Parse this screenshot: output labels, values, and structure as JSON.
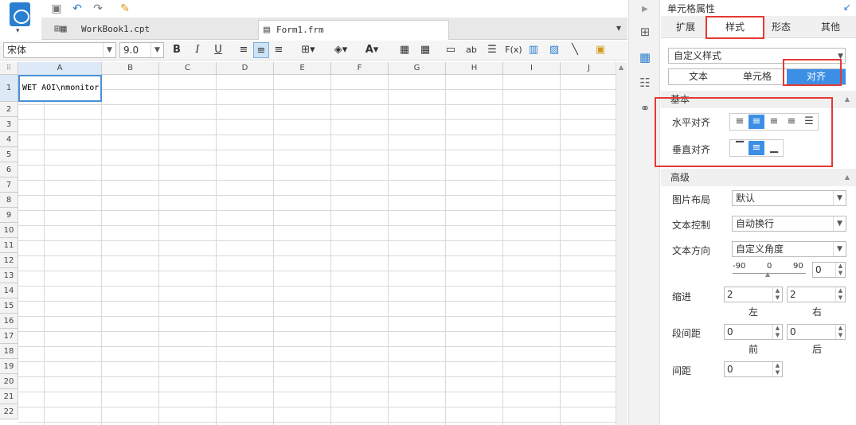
{
  "logo": {
    "icon": "report-designer-icon",
    "dropdown": "▾"
  },
  "quick_toolbar": {
    "save": "save-icon",
    "undo": "undo-icon",
    "redo": "redo-icon",
    "brush": "format-painter-icon"
  },
  "tabs": [
    {
      "label": "WorkBook1.cpt",
      "icon": "workbook-icon",
      "active": false
    },
    {
      "label": "Form1.frm",
      "icon": "form-icon",
      "active": true
    }
  ],
  "format_toolbar": {
    "font": "宋体",
    "font_size": "9.0",
    "bold": "B",
    "italic": "I",
    "underline": "U",
    "text_tool": "ab",
    "formula": "F(x)"
  },
  "grid": {
    "columns": [
      "A",
      "B",
      "C",
      "D",
      "E",
      "F",
      "G",
      "H",
      "I",
      "J"
    ],
    "rows": [
      "1",
      "2",
      "3",
      "4",
      "5",
      "6",
      "7",
      "8",
      "9",
      "10",
      "11",
      "12",
      "13",
      "14",
      "15",
      "16",
      "17",
      "18",
      "19",
      "20",
      "21",
      "22"
    ],
    "cell_a1": "WET AOI\\nmonitor"
  },
  "panel": {
    "title": "单元格属性",
    "tabs": [
      "扩展",
      "样式",
      "形态",
      "其他"
    ],
    "active_tab": "样式",
    "style_select": "自定义样式",
    "subtabs": [
      "文本",
      "单元格",
      "对齐"
    ],
    "active_subtab": "对齐",
    "basic": {
      "header": "基本",
      "h_align_label": "水平对齐",
      "v_align_label": "垂直对齐"
    },
    "advanced": {
      "header": "高级",
      "image_layout_label": "图片布局",
      "image_layout_value": "默认",
      "text_control_label": "文本控制",
      "text_control_value": "自动换行",
      "text_direction_label": "文本方向",
      "text_direction_value": "自定义角度",
      "slider_min": "-90",
      "slider_mid": "0",
      "slider_max": "90",
      "angle_value": "0",
      "indent_label": "缩进",
      "indent_left": "2",
      "indent_right": "2",
      "left_caption": "左",
      "right_caption": "右",
      "para_spacing_label": "段间距",
      "para_before": "0",
      "para_after": "0",
      "before_caption": "前",
      "after_caption": "后",
      "spacing_label": "间距",
      "spacing_value": "0"
    }
  },
  "colors": {
    "accent": "#3d8fe6",
    "highlight": "#e53935"
  }
}
